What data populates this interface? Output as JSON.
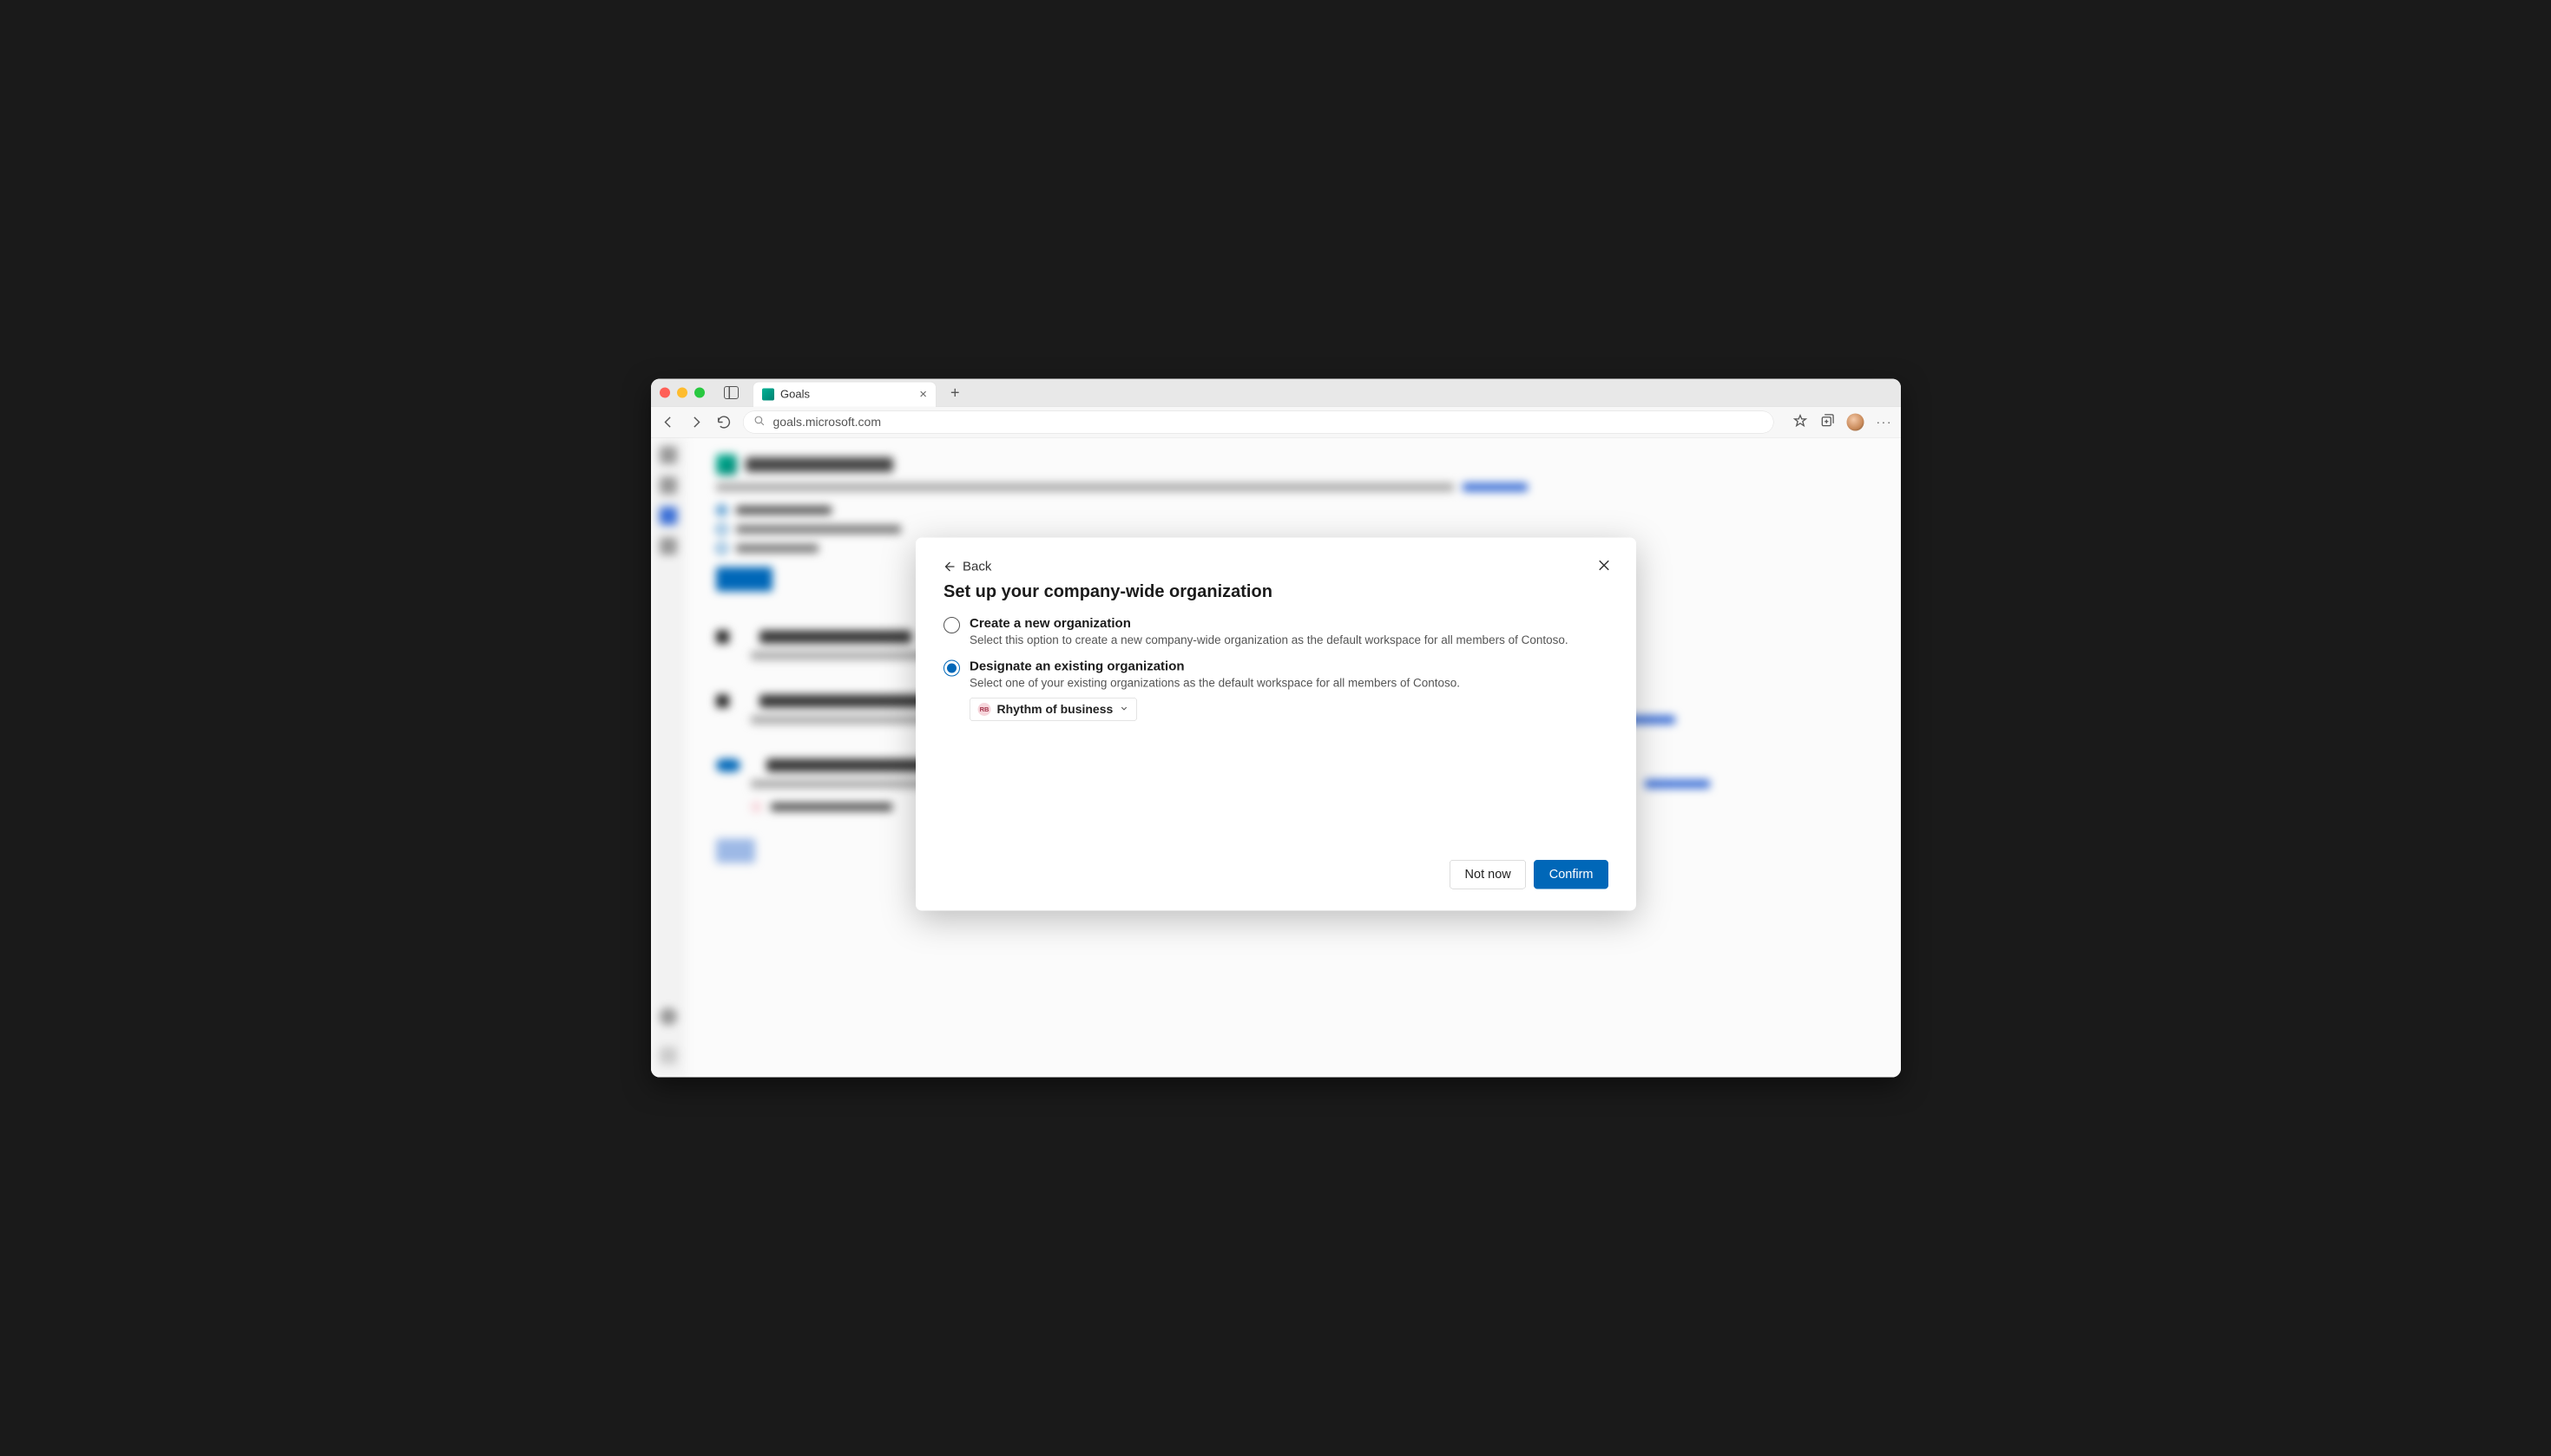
{
  "browser": {
    "tab_title": "Goals",
    "url": "goals.microsoft.com"
  },
  "modal": {
    "back_label": "Back",
    "title": "Set up your company-wide organization",
    "options": [
      {
        "label": "Create a new organization",
        "desc": "Select this option to create a new company-wide organization as the default workspace for all members of Contoso.",
        "selected": false
      },
      {
        "label": "Designate an existing organization",
        "desc": "Select one of your existing organizations as the default workspace for all members of Contoso.",
        "selected": true
      }
    ],
    "org_picker": {
      "badge": "RB",
      "name": "Rhythm of business"
    },
    "footer": {
      "secondary": "Not now",
      "primary": "Confirm"
    }
  }
}
